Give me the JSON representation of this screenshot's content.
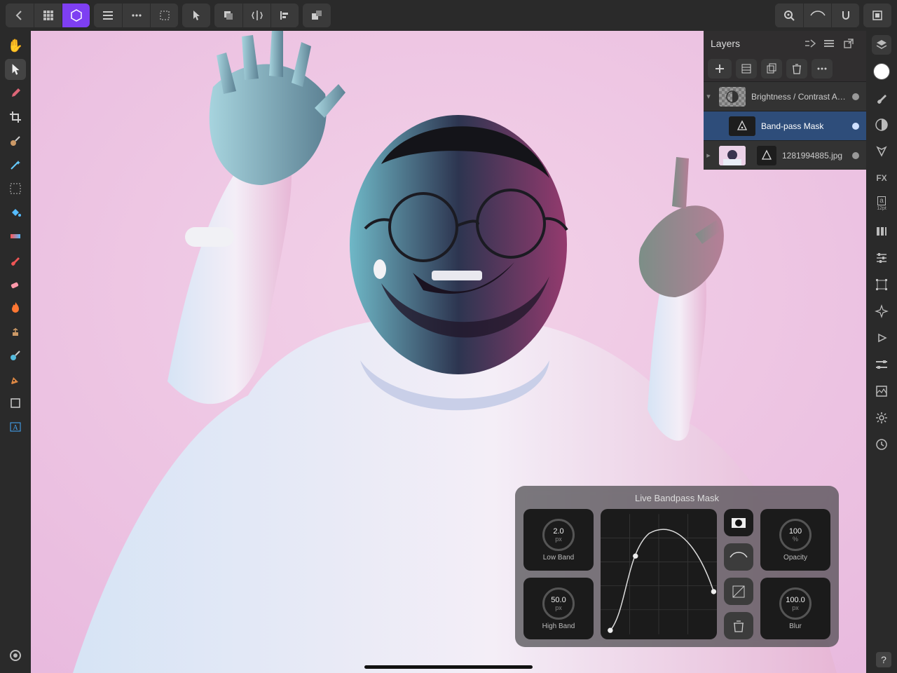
{
  "layers_panel": {
    "title": "Layers",
    "items": [
      {
        "name": "Brightness / Contrast Adj...",
        "kind": "adjustment",
        "expanded": true
      },
      {
        "name": "Band-pass Mask",
        "kind": "mask",
        "selected": true,
        "child": true
      },
      {
        "name": "1281994885.jpg",
        "kind": "image",
        "expanded": false
      }
    ]
  },
  "bandpass": {
    "title": "Live Bandpass Mask",
    "low_band": {
      "label": "Low Band",
      "value": "2.0",
      "unit": "px"
    },
    "high_band": {
      "label": "High Band",
      "value": "50.0",
      "unit": "px"
    },
    "opacity": {
      "label": "Opacity",
      "value": "100",
      "unit": "%"
    },
    "blur": {
      "label": "Blur",
      "value": "100.0",
      "unit": "px"
    }
  }
}
